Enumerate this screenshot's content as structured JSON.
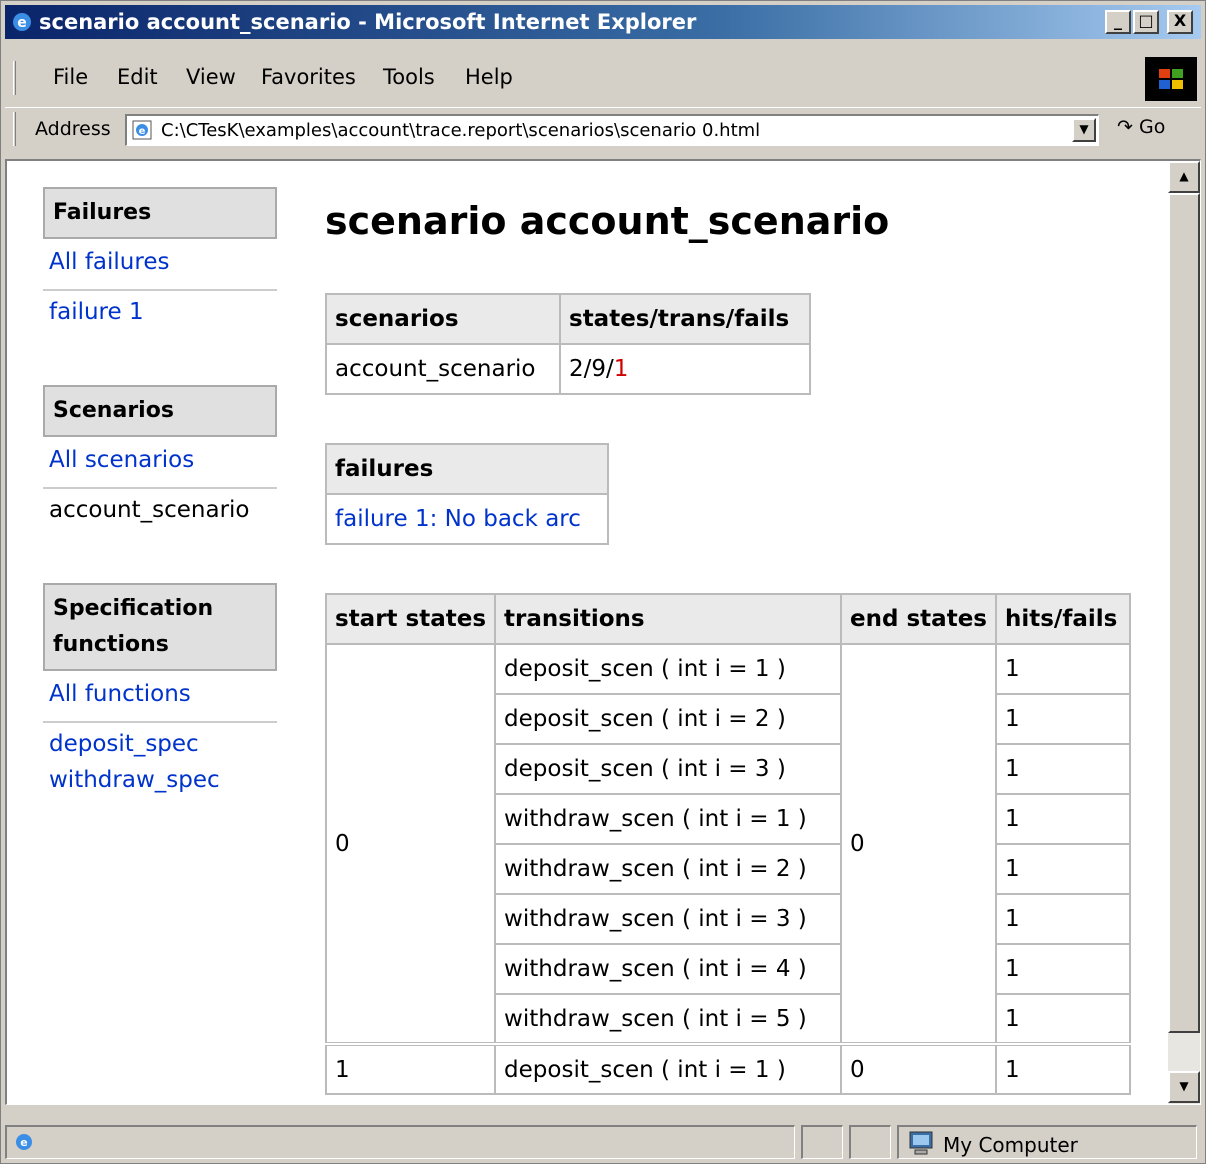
{
  "window": {
    "title": "scenario account_scenario - Microsoft Internet Explorer",
    "minimize_label": "_",
    "maximize_label": "□",
    "close_label": "X"
  },
  "menu": {
    "file": "File",
    "edit": "Edit",
    "view": "View",
    "favorites": "Favorites",
    "tools": "Tools",
    "help": "Help"
  },
  "address": {
    "label": "Address",
    "url": "C:\\CTesK\\examples\\account\\trace.report\\scenarios\\scenario 0.html",
    "go_label": "Go"
  },
  "sidebar": {
    "failures_heading": "Failures",
    "all_failures": "All failures",
    "failure_1": "failure 1",
    "scenarios_heading": "Scenarios",
    "all_scenarios": "All scenarios",
    "current_scenario": "account_scenario",
    "spec_heading": "Specification functions",
    "all_functions": "All functions",
    "functions": [
      "deposit_spec",
      "withdraw_spec"
    ]
  },
  "main": {
    "title": "scenario account_scenario",
    "summary": {
      "headers": [
        "scenarios",
        "states/trans/fails"
      ],
      "scenario": "account_scenario",
      "stats_prefix": "2/9/",
      "stats_fails": "1"
    },
    "failures": {
      "header": "failures",
      "items": [
        "failure 1: No back arc"
      ]
    },
    "transitions": {
      "headers": [
        "start states",
        "transitions",
        "end states",
        "hits/fails"
      ],
      "groups": [
        {
          "start": "0",
          "end": "0",
          "rows": [
            {
              "transition": "deposit_scen ( int i = 1 )",
              "hits": "1"
            },
            {
              "transition": "deposit_scen ( int i = 2 )",
              "hits": "1"
            },
            {
              "transition": "deposit_scen ( int i = 3 )",
              "hits": "1"
            },
            {
              "transition": "withdraw_scen ( int i = 1 )",
              "hits": "1"
            },
            {
              "transition": "withdraw_scen ( int i = 2 )",
              "hits": "1"
            },
            {
              "transition": "withdraw_scen ( int i = 3 )",
              "hits": "1"
            },
            {
              "transition": "withdraw_scen ( int i = 4 )",
              "hits": "1"
            },
            {
              "transition": "withdraw_scen ( int i = 5 )",
              "hits": "1"
            }
          ]
        },
        {
          "start": "1",
          "end": "0",
          "rows": [
            {
              "transition": "deposit_scen ( int i = 1 )",
              "hits": "1"
            }
          ]
        }
      ]
    }
  },
  "status": {
    "zone": "My Computer"
  },
  "colors": {
    "link": "#0033cc",
    "fail": "#d00000",
    "titlebar_start": "#0a246a",
    "chrome": "#d4d0c8"
  }
}
